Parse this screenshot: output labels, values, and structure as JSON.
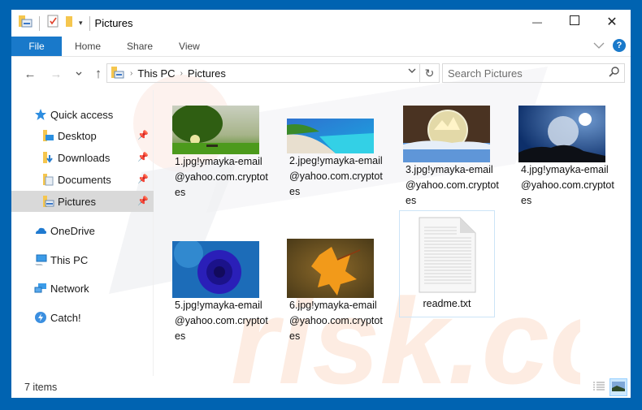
{
  "window": {
    "title": "Pictures",
    "controls": {
      "minimize": "—",
      "maximize": "☐",
      "close": "✕"
    }
  },
  "ribbon": {
    "tabs": [
      {
        "label": "File"
      },
      {
        "label": "Home"
      },
      {
        "label": "Share"
      },
      {
        "label": "View"
      }
    ],
    "help_label": "?"
  },
  "navigation": {
    "back": "←",
    "forward": "→",
    "recent": "⌄",
    "up": "↑",
    "breadcrumb": [
      "This PC",
      "Pictures"
    ],
    "breadcrumb_separator": "›",
    "refresh": "↻",
    "search_placeholder": "Search Pictures"
  },
  "sidebar": {
    "quick_access": {
      "label": "Quick access",
      "icon": "star-icon"
    },
    "pinned": [
      {
        "label": "Desktop",
        "icon": "desktop-folder-icon"
      },
      {
        "label": "Downloads",
        "icon": "downloads-folder-icon"
      },
      {
        "label": "Documents",
        "icon": "documents-folder-icon"
      },
      {
        "label": "Pictures",
        "icon": "pictures-folder-icon",
        "selected": true
      }
    ],
    "locations": [
      {
        "label": "OneDrive",
        "icon": "onedrive-cloud-icon"
      },
      {
        "label": "This PC",
        "icon": "computer-icon"
      },
      {
        "label": "Network",
        "icon": "network-icon"
      },
      {
        "label": "Catch!",
        "icon": "catch-icon"
      }
    ]
  },
  "files": [
    {
      "name": "1.jpg!ymayka-email@yahoo.com.cryptotes",
      "thumbnail": "green-tree-sunset"
    },
    {
      "name": "2.jpeg!ymayka-email@yahoo.com.cryptotes",
      "thumbnail": "tropical-beach"
    },
    {
      "name": "3.jpg!ymayka-email@yahoo.com.cryptotes",
      "thumbnail": "frozen-bubble-snow"
    },
    {
      "name": "4.jpg!ymayka-email@yahoo.com.cryptotes",
      "thumbnail": "frozen-bubble-sun"
    },
    {
      "name": "5.jpg!ymayka-email@yahoo.com.cryptotes",
      "thumbnail": "blue-rose"
    },
    {
      "name": "6.jpg!ymayka-email@yahoo.com.cryptotes",
      "thumbnail": "autumn-maple-leaf"
    },
    {
      "name": "readme.txt",
      "thumbnail": "text-document-icon"
    }
  ],
  "status": {
    "item_count": "7 items"
  },
  "colors": {
    "accent": "#1979ca",
    "desktop": "#0063b1",
    "selected": "#d9d9d9"
  }
}
